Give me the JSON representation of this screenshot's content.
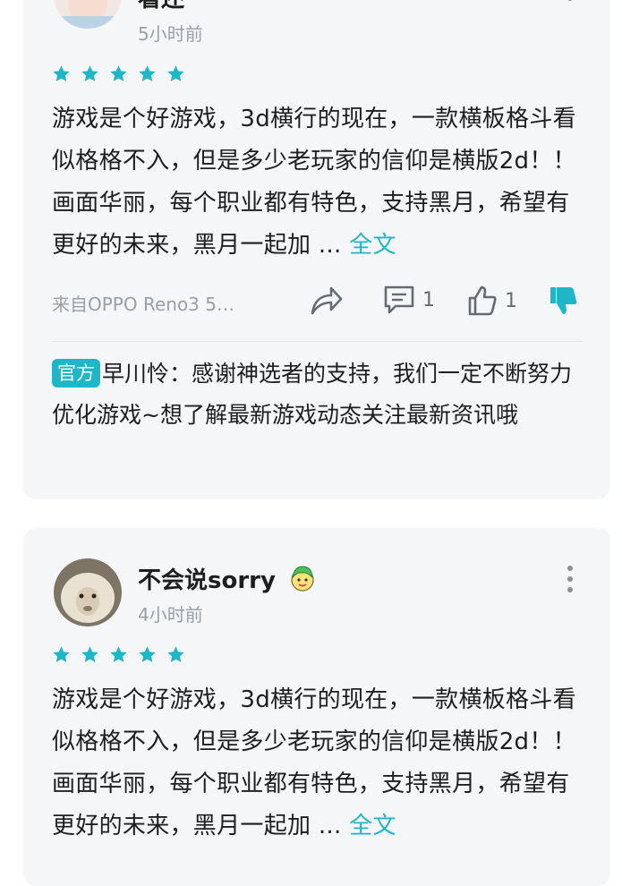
{
  "colors": {
    "accent": "#1fb7c7",
    "card_bg": "#f5f6f8",
    "muted": "#9a9fa6"
  },
  "reviews": [
    {
      "username": "看还",
      "time": "5小时前",
      "rating": 5,
      "text": "游戏是个好游戏，3d横行的现在，一款横板格斗看似格格不入，但是多少老玩家的信仰是横版2d！！画面华丽，每个职业都有特色，支持黑月，希望有更好的未来，黑月一起加 ...",
      "full_label": "全文",
      "device": "来自OPPO Reno3 5…",
      "comment_count": "1",
      "like_count": "1",
      "official_reply": {
        "badge": "官方",
        "text": "早川怜：感谢神选者的支持，我们一定不断努力优化游戏~想了解最新游戏动态关注最新资讯哦"
      }
    },
    {
      "username": "不会说sorry",
      "time": "4小时前",
      "rating": 5,
      "text": "游戏是个好游戏，3d横行的现在，一款横板格斗看似格格不入，但是多少老玩家的信仰是横版2d！！画面华丽，每个职业都有特色，支持黑月，希望有更好的未来，黑月一起加 ...",
      "full_label": "全文"
    }
  ],
  "icons": [
    "star-icon",
    "more-icon",
    "share-icon",
    "comment-icon",
    "like-icon",
    "dislike-icon",
    "emoji-icon"
  ]
}
